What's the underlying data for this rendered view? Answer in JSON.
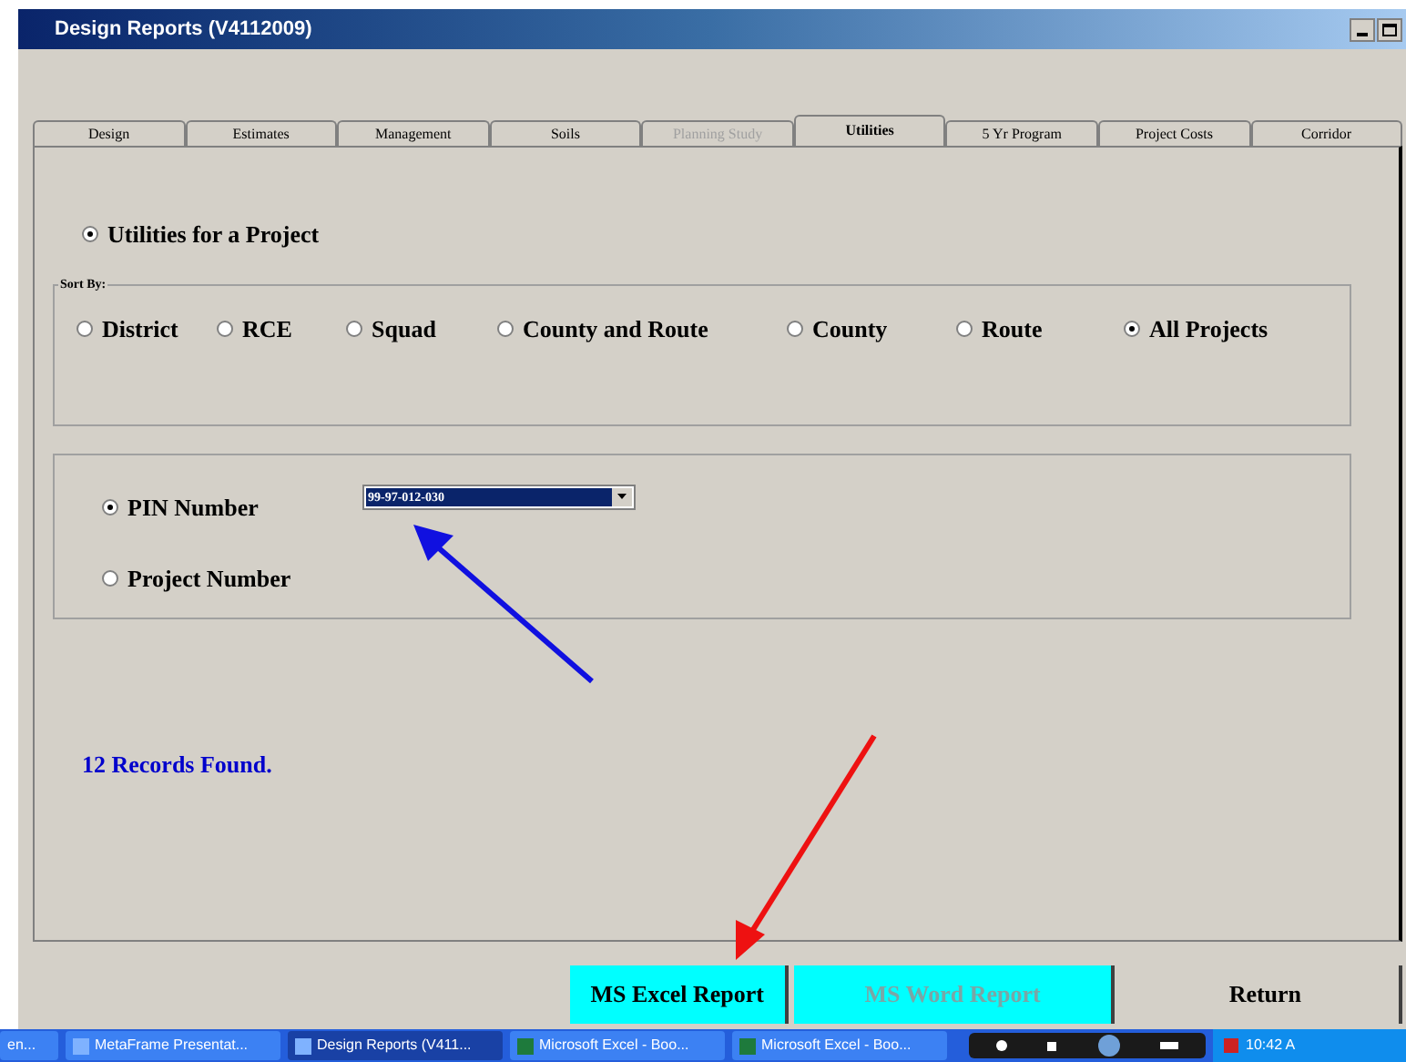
{
  "window": {
    "title": "Design Reports (V4112009)"
  },
  "tabs": [
    {
      "label": "Design",
      "selected": false,
      "disabled": false
    },
    {
      "label": "Estimates",
      "selected": false,
      "disabled": false
    },
    {
      "label": "Management",
      "selected": false,
      "disabled": false
    },
    {
      "label": "Soils",
      "selected": false,
      "disabled": false
    },
    {
      "label": "Planning Study",
      "selected": false,
      "disabled": true
    },
    {
      "label": "Utilities",
      "selected": true,
      "disabled": false
    },
    {
      "label": "5 Yr Program",
      "selected": false,
      "disabled": false
    },
    {
      "label": "Project Costs",
      "selected": false,
      "disabled": false
    },
    {
      "label": "Corridor",
      "selected": false,
      "disabled": false
    }
  ],
  "report_type": {
    "label": "Utilities for a Project",
    "selected": true
  },
  "sort_by": {
    "label": "Sort By:",
    "options": [
      {
        "label": "District",
        "selected": false
      },
      {
        "label": "RCE",
        "selected": false
      },
      {
        "label": "Squad",
        "selected": false
      },
      {
        "label": "County and Route",
        "selected": false
      },
      {
        "label": "County",
        "selected": false
      },
      {
        "label": "Route",
        "selected": false
      },
      {
        "label": "All Projects",
        "selected": true
      }
    ]
  },
  "lookup": {
    "options": [
      {
        "label": "PIN Number",
        "selected": true
      },
      {
        "label": "Project Number",
        "selected": false
      }
    ],
    "dropdown_value": "99-97-012-030"
  },
  "status": "12 Records Found.",
  "buttons": [
    {
      "label": "MS Excel Report",
      "disabled": false
    },
    {
      "label": "MS Word Report",
      "disabled": true
    },
    {
      "label": "Return",
      "disabled": false,
      "kind": "plain"
    }
  ],
  "taskbar": {
    "items": [
      {
        "label": "en...",
        "selected": false
      },
      {
        "label": "MetaFrame Presentat...",
        "selected": false
      },
      {
        "label": "Design Reports (V411...",
        "selected": true
      },
      {
        "label": "Microsoft Excel - Boo...",
        "selected": false
      },
      {
        "label": "Microsoft Excel - Boo...",
        "selected": false
      }
    ],
    "clock": "10:42 A"
  }
}
